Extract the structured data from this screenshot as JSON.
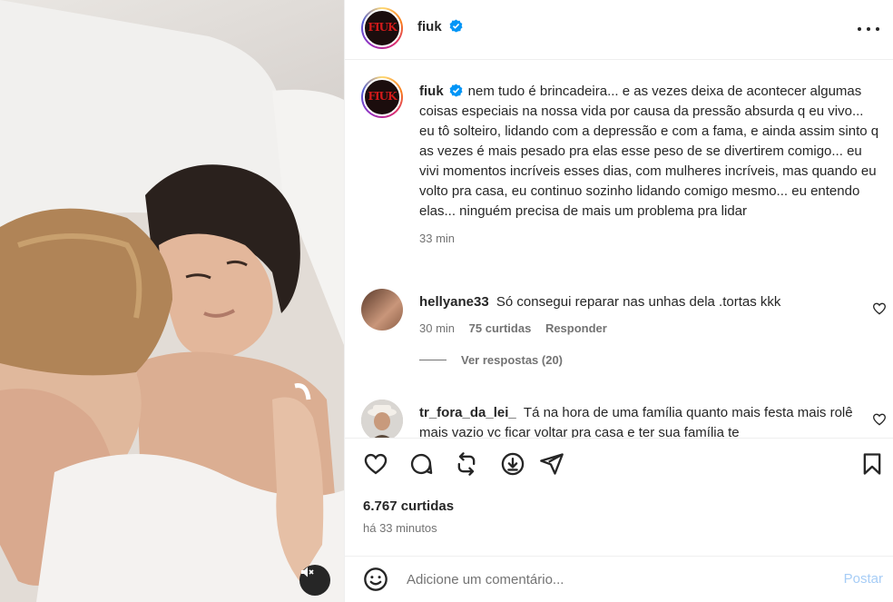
{
  "post": {
    "username": "fiuk",
    "avatar_text": "FIUK",
    "verified": true
  },
  "caption": {
    "username": "fiuk",
    "text": "nem tudo é brincadeira... e as vezes deixa de acontecer algumas coisas especiais na nossa vida por causa da pressão absurda q eu vivo... eu tô solteiro, lidando com a depressão e com a fama, e ainda assim sinto q as vezes é mais pesado pra elas esse peso de se divertirem comigo... eu vivi momentos incríveis esses dias, com mulheres incríveis, mas quando eu volto pra casa, eu continuo sozinho lidando comigo mesmo... eu entendo elas... ninguém precisa de mais um problema pra lidar",
    "time": "33 min"
  },
  "comments": [
    {
      "username": "hellyane33",
      "text": "Só consegui reparar nas unhas dela .tortas kkk",
      "time": "30 min",
      "likes": "75 curtidas",
      "reply_label": "Responder",
      "view_replies": "Ver respostas (20)"
    },
    {
      "username": "tr_fora_da_lei_",
      "text": "Tá na hora de uma família quanto mais festa mais rolê mais vazio vc ficar voltar pra casa e ter sua família te"
    }
  ],
  "footer": {
    "likes": "6.767 curtidas",
    "time": "há 33 minutos",
    "comment_placeholder": "Adicione um comentário...",
    "post_label": "Postar"
  },
  "icons": {
    "verified": "verified-badge-icon",
    "more": "more-options-icon",
    "like": "heart-icon",
    "comment": "comment-icon",
    "repost": "repost-icon",
    "save_reel": "download-icon",
    "share": "share-icon",
    "bookmark": "bookmark-icon",
    "emoji": "emoji-icon",
    "mute": "mute-icon"
  },
  "colors": {
    "verified": "#0095f6",
    "post_button": "#a7cdf6",
    "meta": "#737373"
  }
}
